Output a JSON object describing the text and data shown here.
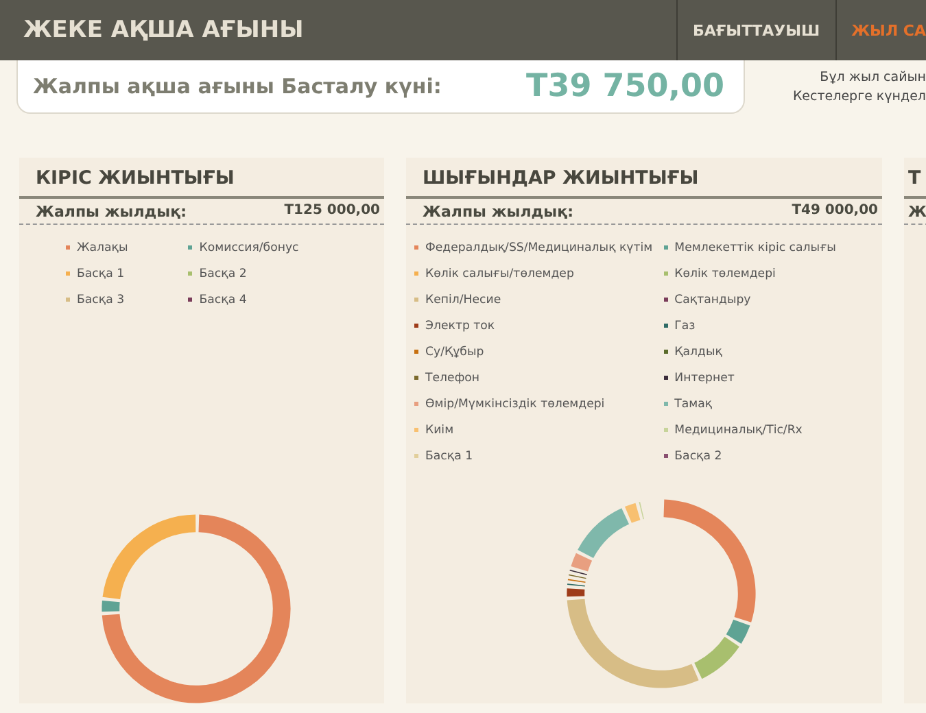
{
  "header": {
    "title": "ЖЕКЕ АҚША АҒЫНЫ",
    "tabs": [
      {
        "label": "БАҒЫТТАУЫШ",
        "selected": false
      },
      {
        "label": "ЖЫЛ СА",
        "selected": true
      }
    ]
  },
  "summary": {
    "label": "Жалпы ақша ағыны Басталу күні:",
    "value": "Т39 750,00"
  },
  "note": [
    "Бұл жыл сайын",
    "Кестелерге күндел"
  ],
  "panels": [
    {
      "title": "КІРІС ЖИЫНТЫҒЫ",
      "total_label": "Жалпы жылдық:",
      "total": "Т125 000,00",
      "legend": [
        {
          "label": "Жалақы",
          "color": "#e4855a"
        },
        {
          "label": "Комиссия/бонус",
          "color": "#5fa394"
        },
        {
          "label": "Басқа 1",
          "color": "#f5b04f"
        },
        {
          "label": "Басқа 2",
          "color": "#a8bf6e"
        },
        {
          "label": "Басқа 3",
          "color": "#d7bd86"
        },
        {
          "label": "Басқа 4",
          "color": "#7a3d5a"
        }
      ]
    },
    {
      "title": "ШЫҒЫНДАР ЖИЫНТЫҒЫ",
      "total_label": "Жалпы жылдық:",
      "total": "Т49 000,00",
      "legend": [
        {
          "label": "Федералдық/SS/Медициналық күтім",
          "color": "#e4855a"
        },
        {
          "label": "Мемлекеттік кіріс салығы",
          "color": "#5fa394"
        },
        {
          "label": "Көлік салығы/төлемдер",
          "color": "#f5b04f"
        },
        {
          "label": "Көлік төлемдері",
          "color": "#a8bf6e"
        },
        {
          "label": "Кепіл/Несие",
          "color": "#d7bd86"
        },
        {
          "label": "Сақтандыру",
          "color": "#7a3d5a"
        },
        {
          "label": "Электр ток",
          "color": "#9e3c1a"
        },
        {
          "label": "Газ",
          "color": "#2f6b66"
        },
        {
          "label": "Су/Құбыр",
          "color": "#c7700f"
        },
        {
          "label": "Қалдық",
          "color": "#5a6b2a"
        },
        {
          "label": "Телефон",
          "color": "#7b6a2c"
        },
        {
          "label": "Интернет",
          "color": "#3b2d3b"
        },
        {
          "label": "Өмір/Мүмкінсіздік төлемдері",
          "color": "#e89f80"
        },
        {
          "label": "Тамақ",
          "color": "#7fb8ab"
        },
        {
          "label": "Киім",
          "color": "#f8c070"
        },
        {
          "label": "Медициналық/Тіс/Rx",
          "color": "#c7d49a"
        },
        {
          "label": "Басқа 1",
          "color": "#e2cf9b"
        },
        {
          "label": "Басқа 2",
          "color": "#8a5070"
        }
      ]
    },
    {
      "title": "Т",
      "total_label": "Ж"
    }
  ]
}
